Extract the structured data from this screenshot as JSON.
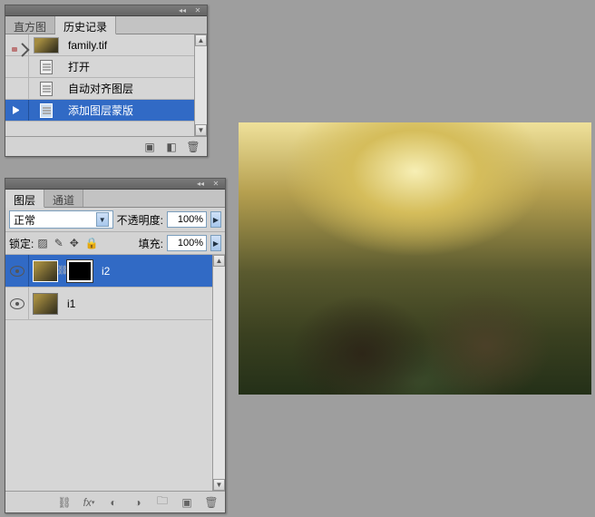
{
  "history_panel": {
    "tabs": [
      "直方图",
      "历史记录"
    ],
    "active_tab": 1,
    "snapshot_file": "family.tif",
    "items": [
      {
        "label": "打开"
      },
      {
        "label": "自动对齐图层"
      },
      {
        "label": "添加图层蒙版",
        "selected": true
      }
    ]
  },
  "layers_panel": {
    "tabs": [
      "图层",
      "通道"
    ],
    "active_tab": 0,
    "blend_mode": "正常",
    "opacity_label": "不透明度:",
    "opacity_value": "100%",
    "lock_label": "锁定:",
    "fill_label": "填充:",
    "fill_value": "100%",
    "layers": [
      {
        "name": "i2",
        "selected": true,
        "has_mask": true
      },
      {
        "name": "i1",
        "selected": false,
        "has_mask": false
      }
    ]
  }
}
